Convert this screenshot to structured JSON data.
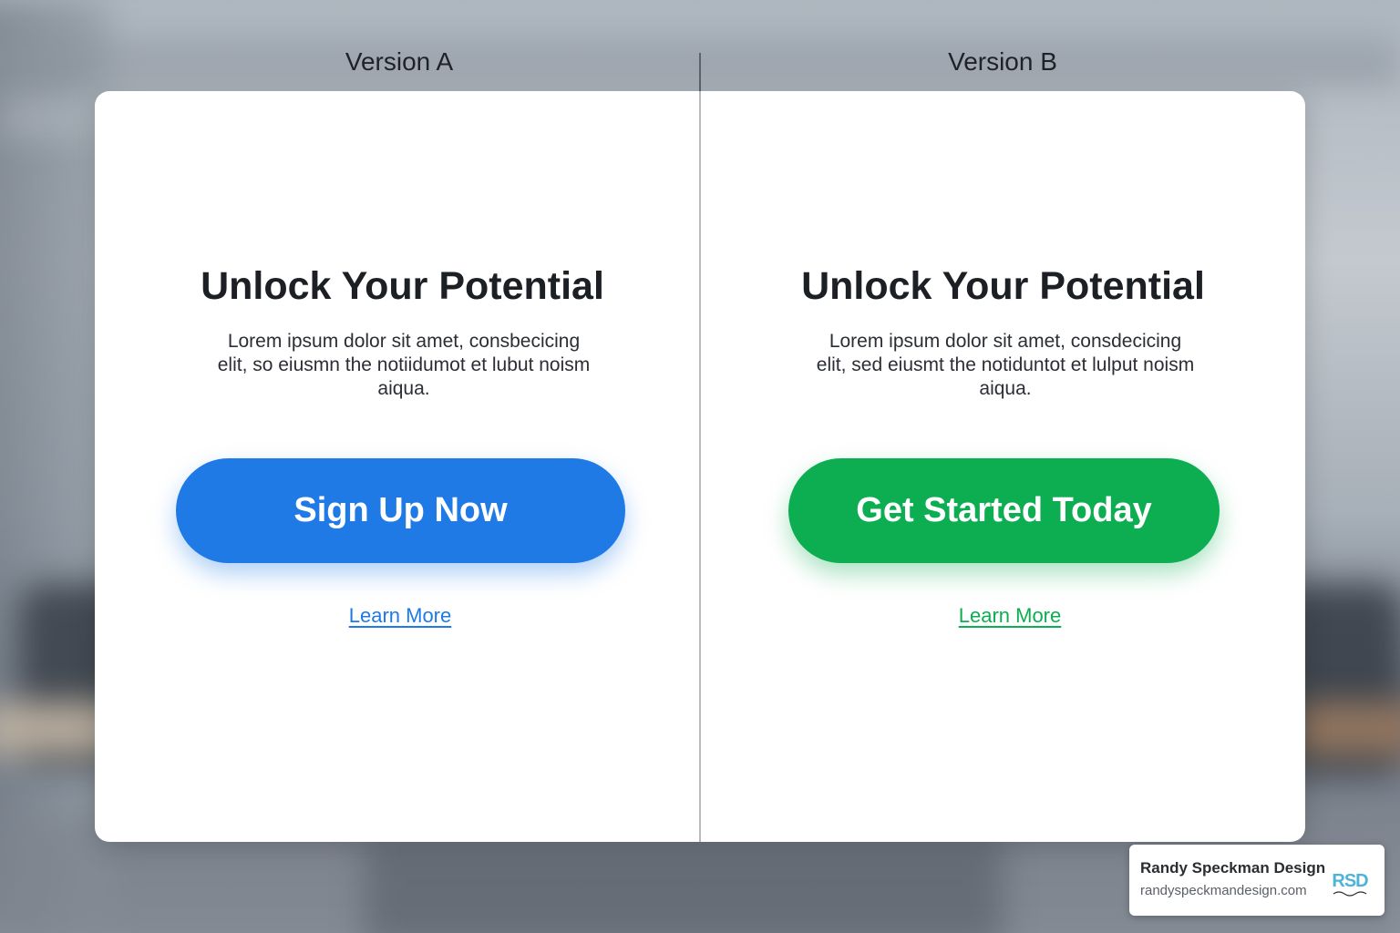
{
  "labels": {
    "version_a": "Version A",
    "version_b": "Version B"
  },
  "version_a": {
    "headline": "Unlock Your Potential",
    "body": "Lorem ipsum dolor sit amet, consbecicing elit, so eiusmn the notiidumot et lubut noism aiqua.",
    "cta_label": "Sign Up Now",
    "link_label": "Learn More",
    "accent_color": "#1f7ae6"
  },
  "version_b": {
    "headline": "Unlock Your Potential",
    "body": "Lorem ipsum dolor sit amet, consdecicing elit, sed eiusmt the notiduntot et lulput noism aiqua.",
    "cta_label": "Get Started Today",
    "link_label": "Learn More",
    "accent_color": "#0dae52"
  },
  "brand": {
    "name": "Randy Speckman Design",
    "url": "randyspeckmandesign.com",
    "logo_text": "RSD",
    "logo_color": "#4fb3d9"
  }
}
